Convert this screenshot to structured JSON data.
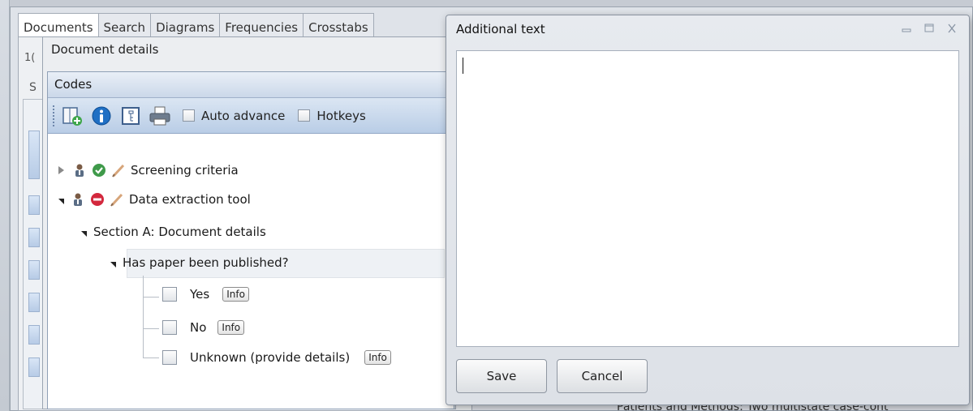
{
  "main_window": {
    "tabs": [
      "Documents",
      "Search",
      "Diagrams",
      "Frequencies",
      "Crosstabs"
    ],
    "partial_label_1": "1(",
    "partial_label_2": "S",
    "bottom_text": "Patients and Methods: Two multistate case-cont"
  },
  "document_details": {
    "title": "Document details"
  },
  "codes_panel": {
    "title": "Codes",
    "toolbar": {
      "auto_advance_label": "Auto advance",
      "auto_advance_checked": false,
      "hotkeys_label": "Hotkeys",
      "hotkeys_checked": false
    },
    "tree": {
      "screening_criteria": "Screening criteria",
      "data_extraction_tool": "Data extraction tool",
      "section_a": "Section A: Document details",
      "question": "Has paper been published?",
      "options": [
        {
          "label": "Yes",
          "info": "Info",
          "checked": false
        },
        {
          "label": "No",
          "info": "Info",
          "checked": false
        },
        {
          "label": "Unknown (provide details)",
          "info": "Info",
          "checked": false
        }
      ]
    }
  },
  "dialog": {
    "title": "Additional text",
    "text_value": "",
    "save_label": "Save",
    "cancel_label": "Cancel"
  },
  "icons": {
    "add_code": "add-code-icon",
    "info": "info-icon",
    "properties": "properties-icon",
    "print": "print-icon",
    "user": "user-icon",
    "check_status": "check-status-icon",
    "stop_status": "stop-status-icon",
    "pencil": "pencil-icon"
  },
  "colors": {
    "toolbar_blue": "#b9cde6",
    "status_green": "#3f9a4a",
    "status_red": "#d3283d",
    "info_blue": "#1f6fc4"
  }
}
